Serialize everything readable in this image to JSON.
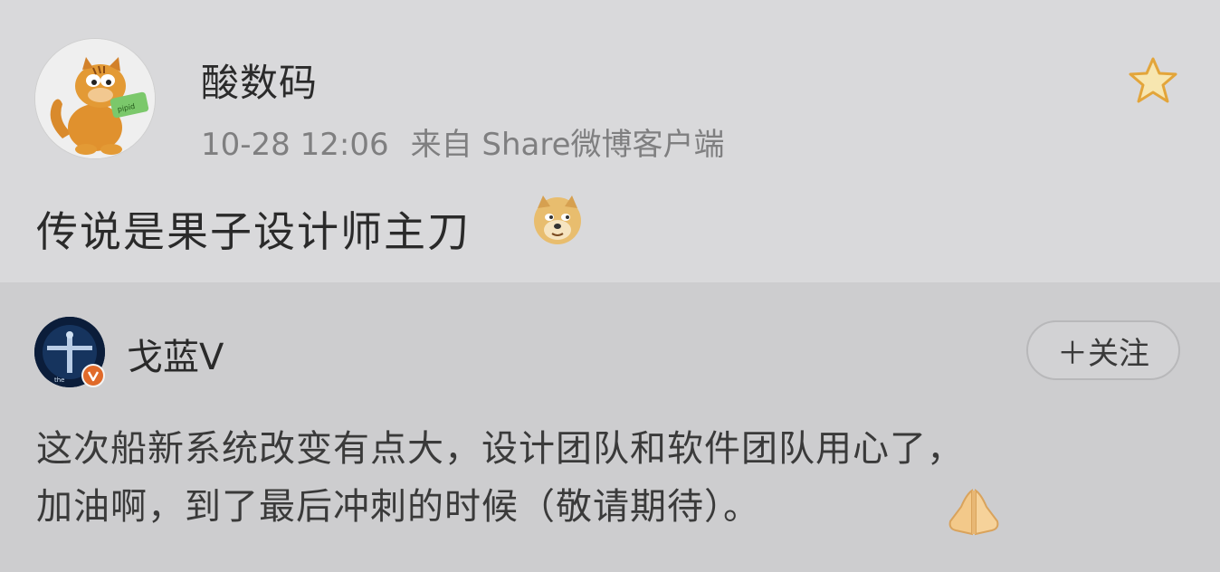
{
  "post": {
    "username": "酸数码",
    "timestamp": "10-28 12:06",
    "source": "来自 Share微博客户端",
    "text": "传说是果子设计师主刀",
    "emoji": "doge-emoji",
    "favorite_icon": "star-icon"
  },
  "repost": {
    "username": "戈蓝V",
    "follow_label": "＋关注",
    "text_line1": "这次船新系统改变有点大，设计团队和软件团队用心了，",
    "text_line2": "加油啊，到了最后冲刺的时候（敬请期待）。",
    "emoji": "praying-hands-emoji",
    "badge": "verified-badge"
  },
  "colors": {
    "background": "#d6d6d8",
    "repost_background": "#cdcdcf",
    "star": "#e3a53a",
    "badge": "#e06a2a"
  }
}
